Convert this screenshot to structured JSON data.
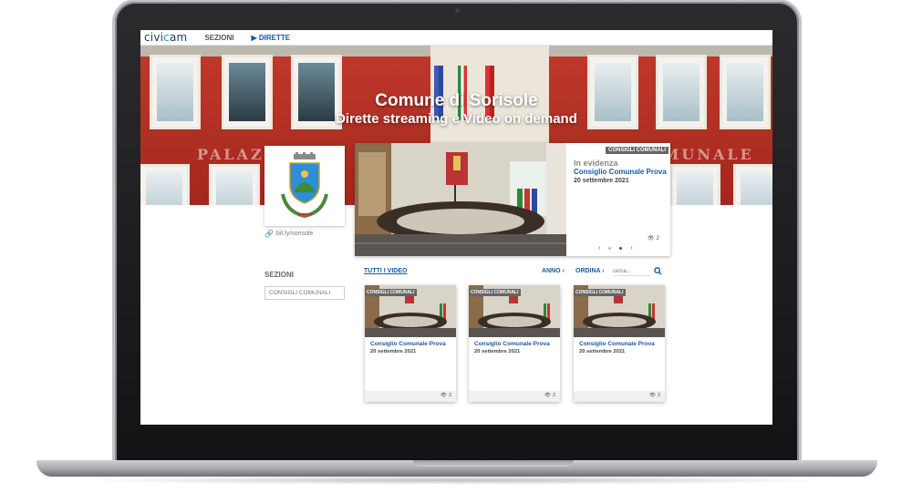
{
  "nav": {
    "logo": "civicam",
    "sections_label": "SEZIONI",
    "live_label": "▶ DIRETTE"
  },
  "hero": {
    "title": "Comune di Sorisole",
    "subtitle": "Dirette streaming e Video on demand",
    "building_text_left": "PALAZZO",
    "building_text_right": "COMUNALE"
  },
  "sidebar_info": {
    "shortlink": "bit.ly/sorisole"
  },
  "featured": {
    "badge": "CONSIGLI COMUNALI",
    "label": "In evidenza",
    "title": "Consiglio Comunale Prova",
    "date": "20 settembre 2021",
    "views": "2",
    "prev": "‹",
    "next": "›"
  },
  "sidebar": {
    "title": "SEZIONI",
    "items": [
      {
        "label": "CONSIGLI COMUNALI"
      }
    ]
  },
  "filters": {
    "all_videos": "TUTTI I VIDEO",
    "year": "ANNO ›",
    "order": "ORDINA ›",
    "search_placeholder": "cerca..."
  },
  "videos": [
    {
      "badge": "CONSIGLI COMUNALI",
      "title": "Consiglio Comunale Prova",
      "date": "20 settembre 2021",
      "views": "2"
    },
    {
      "badge": "CONSIGLI COMUNALI",
      "title": "Consiglio Comunale Prova",
      "date": "20 settembre 2021",
      "views": "2"
    },
    {
      "badge": "CONSIGLI COMUNALI",
      "title": "Consiglio Comunale Prova",
      "date": "20 settembre 2021",
      "views": "2"
    }
  ],
  "colors": {
    "accent": "#1a5aa3",
    "facade": "#c0392b",
    "badge": "#666666"
  }
}
